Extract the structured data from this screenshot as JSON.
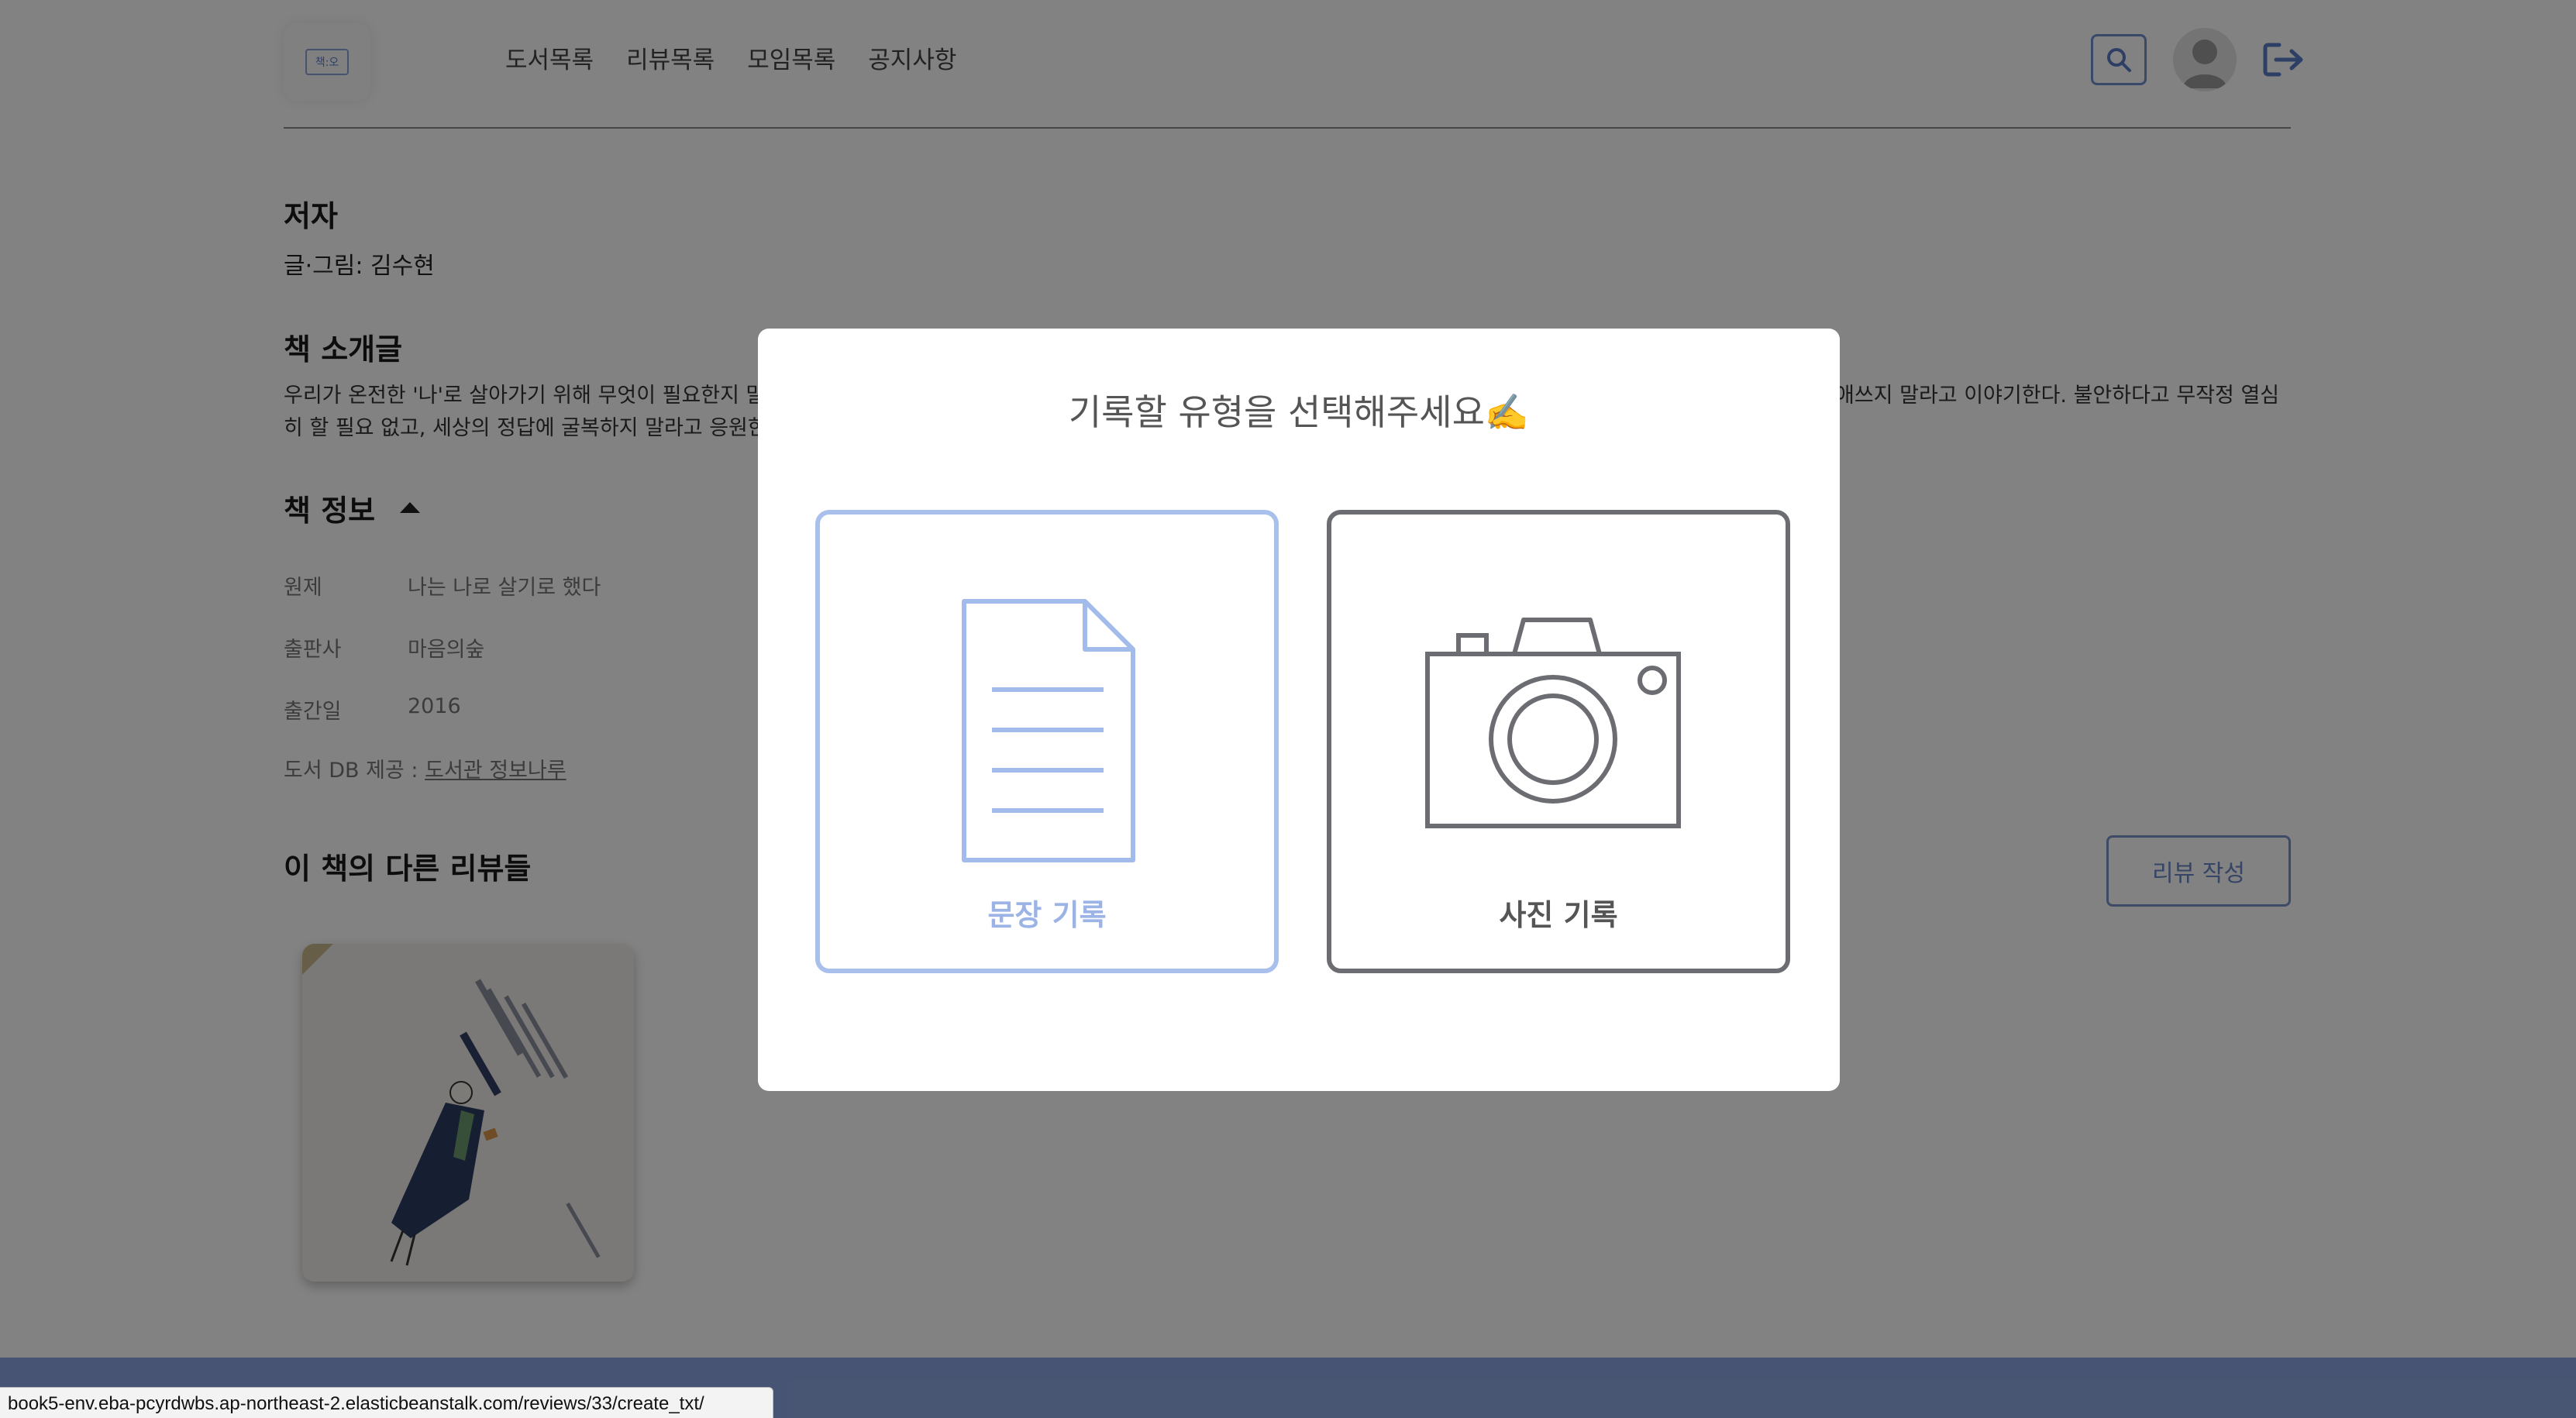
{
  "header": {
    "logo_text": "책:오",
    "nav": [
      "도서목록",
      "리뷰목록",
      "모임목록",
      "공지사항"
    ]
  },
  "book": {
    "author_heading": "저자",
    "author_value": "글·그림: 김수현",
    "intro_heading": "책 소개글",
    "intro_line1": "우리가 온전한 '나'로 살아가기 위해 무엇이 필요한지 말",
    "intro_line1_right": "애쓰지 말라고 이야기한다. 불안하다고 무작정 열심",
    "intro_line2": "히 할 필요 없고, 세상의 정답에 굴복하지 말라고 응원한",
    "info_heading": "책 정보",
    "info": [
      {
        "key": "원제",
        "value": "나는 나로 살기로 했다"
      },
      {
        "key": "출판사",
        "value": "마음의숲"
      },
      {
        "key": "출간일",
        "value": "2016"
      }
    ],
    "db_prefix": "도서 DB 제공 : ",
    "db_link": "도서관 정보나루"
  },
  "reviews": {
    "heading": "이 책의 다른 리뷰들",
    "write_button": "리뷰 작성"
  },
  "modal": {
    "title": "기록할 유형을 선택해주세요✍️",
    "text_option": "문장 기록",
    "photo_option": "사진 기록"
  },
  "status_bar": {
    "url": "book5-env.eba-pcyrdwbs.ap-northeast-2.elasticbeanstalk.com/reviews/33/create_txt/"
  },
  "colors": {
    "accent": "#a9c0ec",
    "accent_dark": "#6f8fd0",
    "neutral_border": "#6b6d72",
    "footer": "#8ea6e2"
  },
  "icons": [
    "search-icon",
    "avatar-icon",
    "logout-icon",
    "document-icon",
    "camera-icon",
    "caret-up-icon"
  ]
}
